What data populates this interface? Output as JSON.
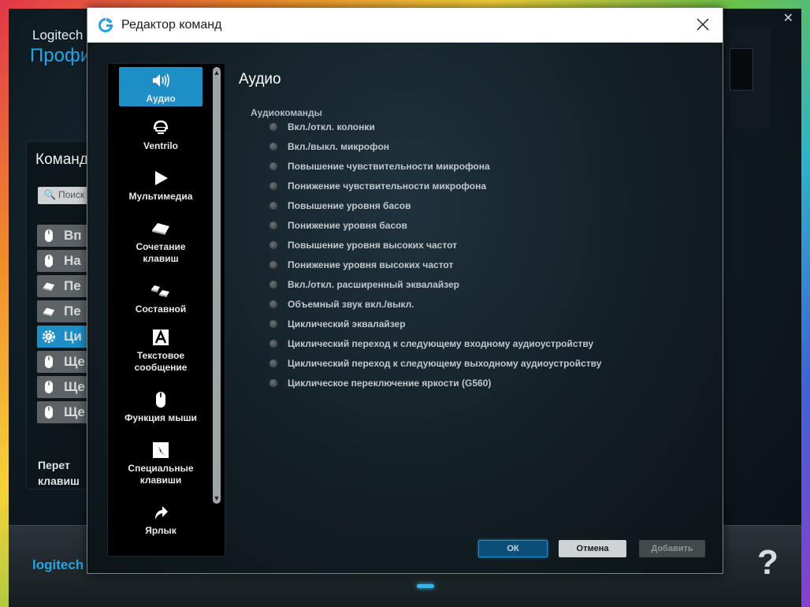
{
  "background": {
    "brand": "Logitech",
    "profile_label": "Профи",
    "panel_title": "Команд",
    "search_placeholder": "Поиск",
    "rows": [
      {
        "label": "Вп",
        "icon": "mouse"
      },
      {
        "label": "На",
        "icon": "mouse"
      },
      {
        "label": "Пе",
        "icon": "key"
      },
      {
        "label": "Пе",
        "icon": "key"
      },
      {
        "label": "Ци",
        "icon": "gear",
        "selected": true
      },
      {
        "label": "Ще",
        "icon": "mouse"
      },
      {
        "label": "Ще",
        "icon": "mouse"
      },
      {
        "label": "Ще",
        "icon": "mouse"
      }
    ],
    "panel_footer_line1": "Перет",
    "panel_footer_line2": "клавиш",
    "logo": "logitech",
    "help": "?",
    "close": "✕"
  },
  "dialog": {
    "title": "Редактор команд",
    "categories": [
      {
        "label": "Аудио",
        "icon": "speaker-icon",
        "selected": true
      },
      {
        "label": "Ventrilo",
        "icon": "headset-icon"
      },
      {
        "label": "Мультимедиа",
        "icon": "play-icon"
      },
      {
        "label": "Сочетание клавиш",
        "line1": "Сочетание",
        "line2": "клавиш",
        "icon": "key-icon"
      },
      {
        "label": "Составной",
        "icon": "multi-key-icon"
      },
      {
        "label": "Текстовое сообщение",
        "line1": "Текстовое",
        "line2": "сообщение",
        "icon": "text-a-icon"
      },
      {
        "label": "Функция мыши",
        "icon": "mouse-icon"
      },
      {
        "label": "Специальные клавиши",
        "line1": "Специальные",
        "line2": "клавиши",
        "icon": "special-key-icon"
      },
      {
        "label": "Ярлык",
        "icon": "shortcut-arrow-icon"
      }
    ],
    "content_title": "Аудио",
    "group_label": "Аудиокоманды",
    "commands": [
      "Вкл./откл. колонки",
      "Вкл./выкл. микрофон",
      "Повышение чувствительности микрофона",
      "Понижение чувствительности микрофона",
      "Повышение уровня басов",
      "Понижение уровня басов",
      "Повышение уровня высоких частот",
      "Понижение уровня высоких частот",
      "Вкл./откл. расширенный эквалайзер",
      "Объемный звук вкл./выкл.",
      "Циклический эквалайзер",
      "Циклический переход к следующему входному аудиоустройству",
      "Циклический переход к следующему выходному аудиоустройству",
      "Циклическое переключение яркости (G560)"
    ],
    "buttons": {
      "ok": "ОК",
      "cancel": "Отмена",
      "add": "Добавить"
    }
  },
  "colors": {
    "accent": "#1d8fc6",
    "brand_blue": "#22a6e6"
  }
}
